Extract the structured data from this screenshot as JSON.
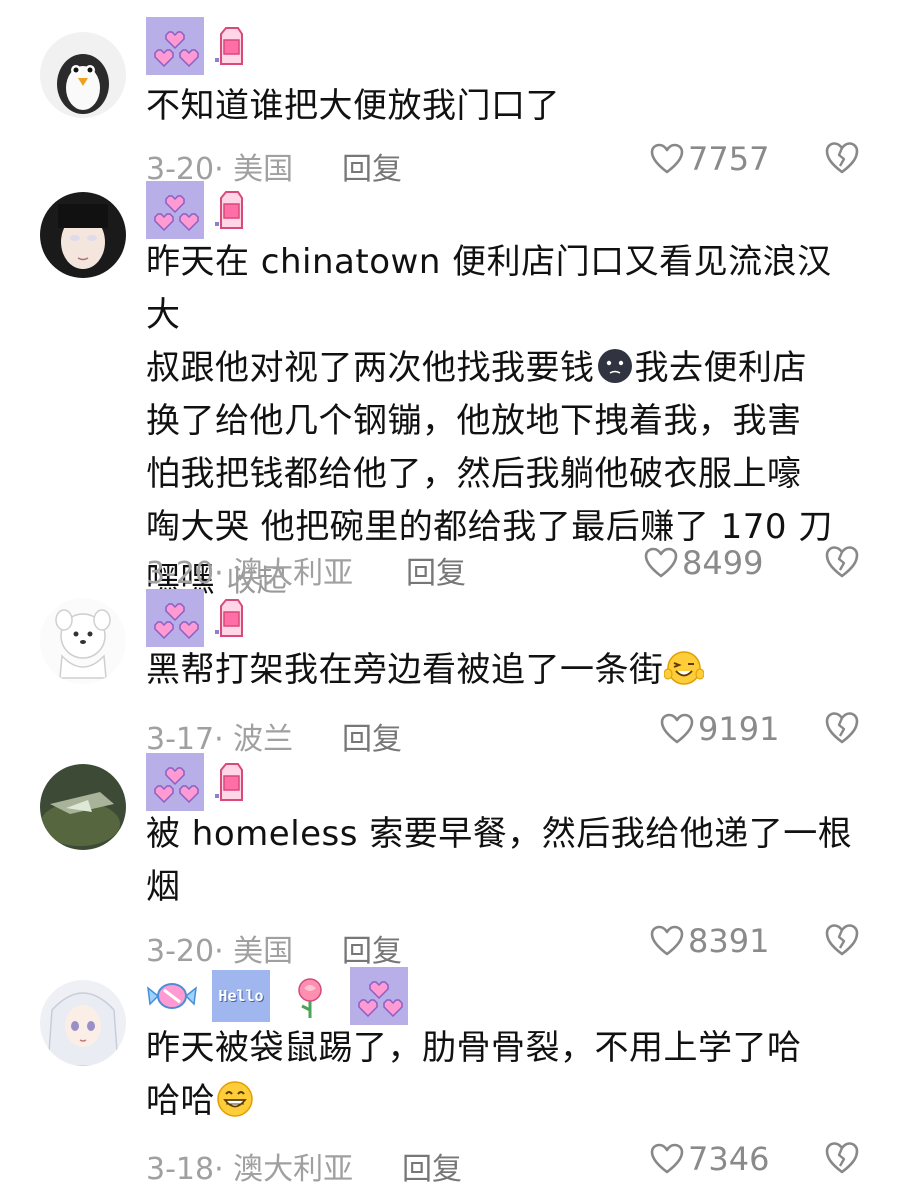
{
  "comments": [
    {
      "avatar": "penguin-avatar",
      "text": "不知道谁把大便放我门口了",
      "date_location": "3-20· 美国",
      "reply_label": "回复",
      "likes": "7757"
    },
    {
      "avatar": "anime-girl-avatar",
      "text_lines": [
        "昨天在 chinatown 便利店门口又看见流浪汉大",
        "叔跟他对视了两次他找我要钱",
        "我去便利店",
        "换了给他几个钢镚，他放地下拽着我，我害",
        "怕我把钱都给他了，然后我躺他破衣服上嚎",
        "啕大哭 他把碗里的都给我了最后赚了 170 刀",
        "嘿嘿"
      ],
      "collapse_label": "收起",
      "date_location": "3-20· 澳大利亚",
      "reply_label": "回复",
      "likes": "8499"
    },
    {
      "avatar": "white-dog-avatar",
      "text": "黑帮打架我在旁边看被追了一条街",
      "date_location": "3-17· 波兰",
      "reply_label": "回复",
      "likes": "9191"
    },
    {
      "avatar": "green-scene-avatar",
      "text_lines": [
        "被 homeless 索要早餐，然后我给他递了一根",
        "烟"
      ],
      "date_location": "3-20· 美国",
      "reply_label": "回复",
      "likes": "8391"
    },
    {
      "avatar": "white-hair-girl-avatar",
      "text_lines": [
        "昨天被袋鼠踢了，肋骨骨裂，不用上学了哈",
        "哈哈"
      ],
      "badge_hello": "Hello",
      "date_location": "3-18· 澳大利亚",
      "reply_label": "回复",
      "likes": "7346"
    }
  ],
  "colors": {
    "badge_purple": "#b8aee8",
    "heart_pink": "#ff9bd2",
    "meta_gray": "#a0a0a0"
  }
}
